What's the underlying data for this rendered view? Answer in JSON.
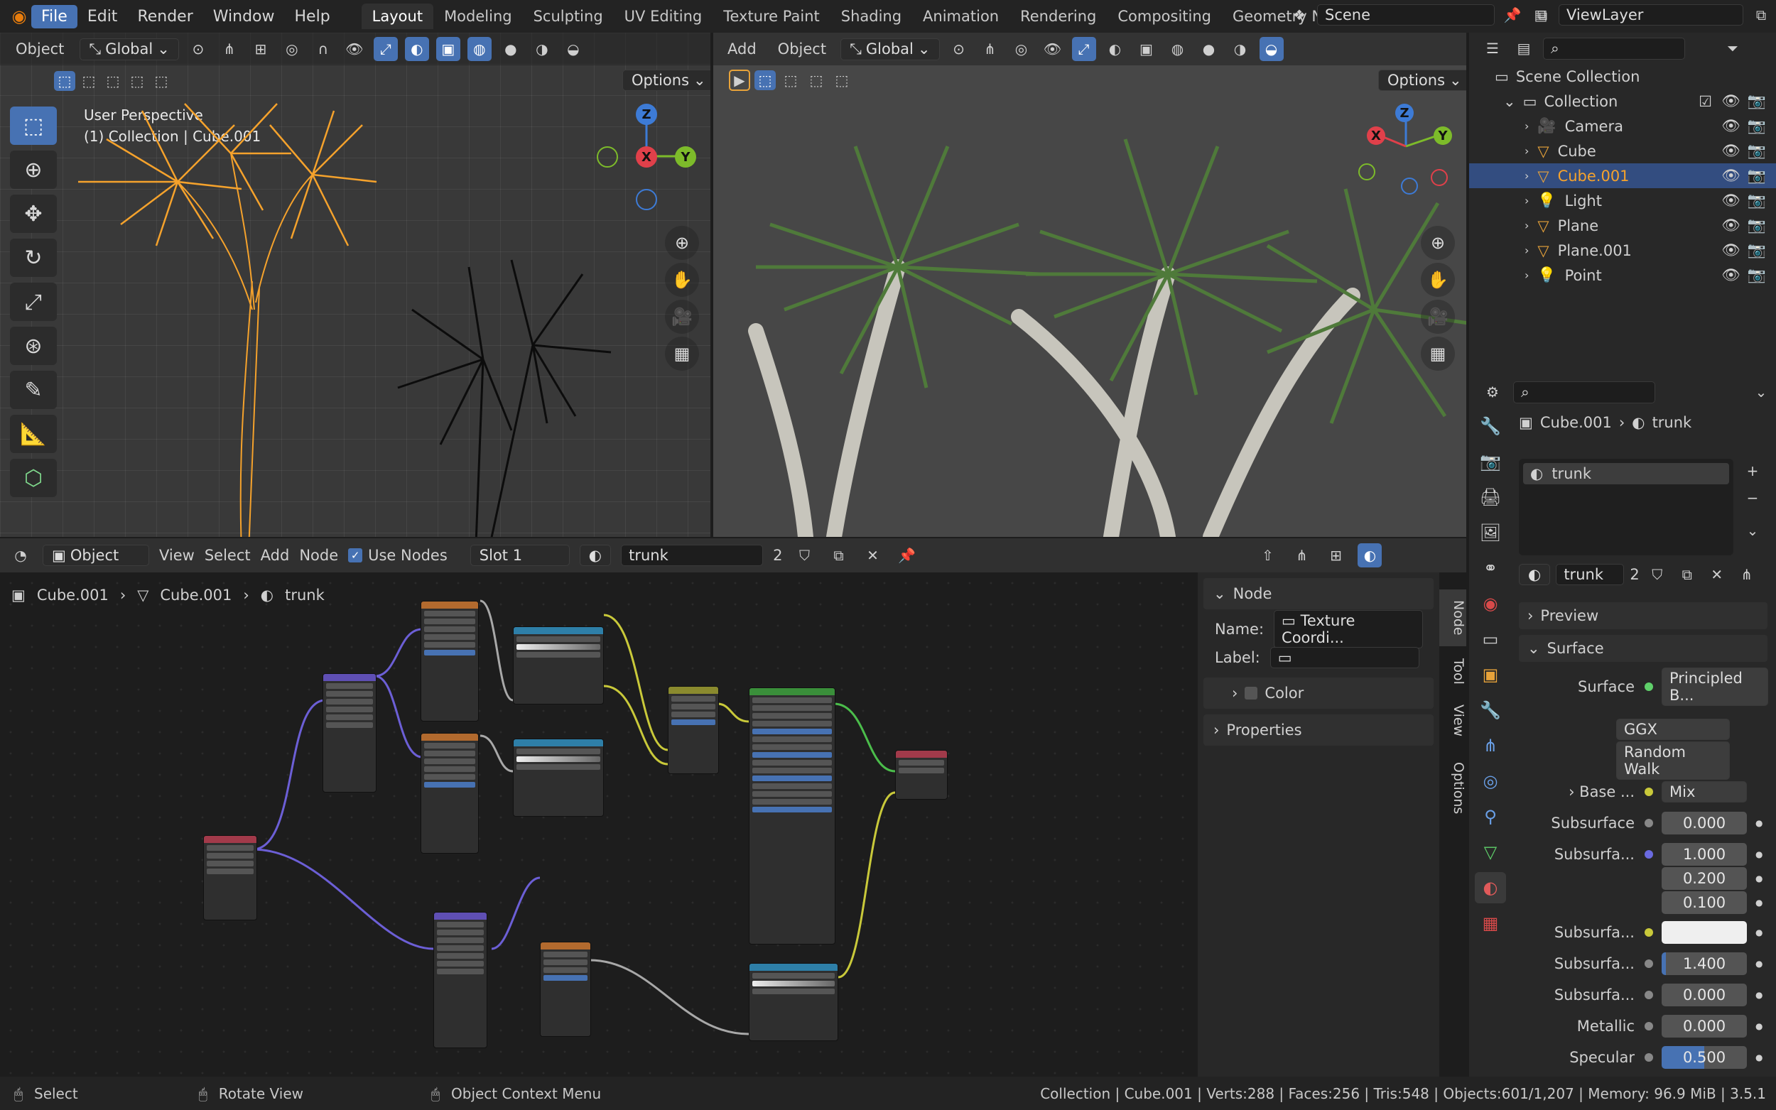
{
  "menus": [
    "File",
    "Edit",
    "Render",
    "Window",
    "Help"
  ],
  "workspaces": [
    "Layout",
    "Modeling",
    "Sculpting",
    "UV Editing",
    "Texture Paint",
    "Shading",
    "Animation",
    "Rendering",
    "Compositing",
    "Geometry Nodes"
  ],
  "scene": "Scene",
  "view_layer": "ViewLayer",
  "viewport_left": {
    "mode": "Object",
    "orientation": "Global",
    "options": "Options",
    "overlay_title": "User Perspective",
    "overlay_sub": "(1) Collection | Cube.001"
  },
  "viewport_right": {
    "add": "Add",
    "object": "Object",
    "orientation": "Global",
    "options": "Options"
  },
  "axes": {
    "z": "Z",
    "x": "X",
    "y": "Y"
  },
  "outliner": {
    "root": "Scene Collection",
    "collection": "Collection",
    "items": [
      {
        "name": "Camera",
        "selected": false
      },
      {
        "name": "Cube",
        "selected": false
      },
      {
        "name": "Cube.001",
        "selected": true
      },
      {
        "name": "Light",
        "selected": false
      },
      {
        "name": "Plane",
        "selected": false
      },
      {
        "name": "Plane.001",
        "selected": false
      },
      {
        "name": "Point",
        "selected": false
      }
    ]
  },
  "node_editor": {
    "mode": "Object",
    "view": "View",
    "select": "Select",
    "add": "Add",
    "node": "Node",
    "use_nodes": "Use Nodes",
    "slot": "Slot 1",
    "material": "trunk",
    "users": "2",
    "breadcrumb": [
      "Cube.001",
      "Cube.001",
      "trunk"
    ],
    "panel_title": "Node",
    "name_label": "Name:",
    "name_value": "Texture Coordi...",
    "label_label": "Label:",
    "color_label": "Color",
    "properties_label": "Properties",
    "side_tabs": [
      "Node",
      "Tool",
      "View",
      "Options"
    ]
  },
  "properties": {
    "object": "Cube.001",
    "material": "trunk",
    "slot_item": "trunk",
    "users": "2",
    "preview": "Preview",
    "surface_section": "Surface",
    "surface_label": "Surface",
    "surface_value": "Principled B...",
    "distribution": "GGX",
    "subsurface_method": "Random Walk",
    "base_label": "Base ...",
    "base_value": "Mix",
    "rows": [
      {
        "label": "Subsurface",
        "value": "0.000"
      },
      {
        "label": "Subsurfa...",
        "value": "1.000"
      },
      {
        "label": "",
        "value": "0.200"
      },
      {
        "label": "",
        "value": "0.100"
      },
      {
        "label": "Subsurfa...",
        "value": ""
      },
      {
        "label": "Subsurfa...",
        "value": "1.400"
      },
      {
        "label": "Subsurfa...",
        "value": "0.000"
      },
      {
        "label": "Metallic",
        "value": "0.000"
      },
      {
        "label": "Specular",
        "value": "0.500"
      }
    ]
  },
  "status": {
    "select": "Select",
    "rotate": "Rotate View",
    "context": "Object Context Menu",
    "stats": "Collection | Cube.001 | Verts:288 | Faces:256 | Tris:548 | Objects:601/1,207 | Memory: 96.9 MiB | 3.5.1"
  },
  "colors": {
    "accent": "#4772b3",
    "selected_object": "#f5a22c",
    "foliage": "#4f7a3a"
  }
}
